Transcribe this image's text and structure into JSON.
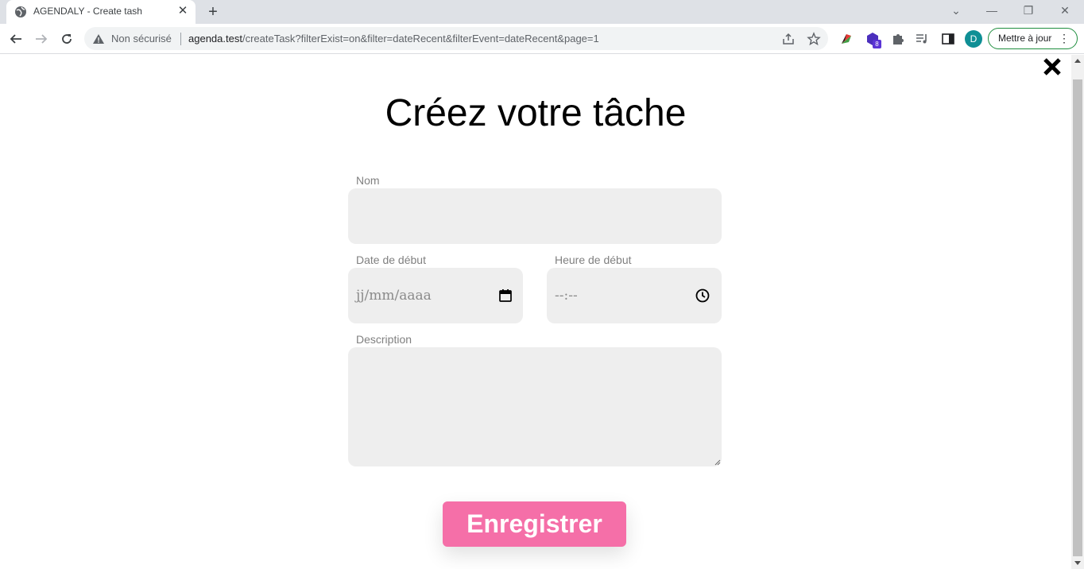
{
  "browser": {
    "tab_title": "AGENDALY - Create tash",
    "security_label": "Non sécurisé",
    "url_host": "agenda.test",
    "url_path": "/createTask?filterExist=on&filter=dateRecent&filterEvent=dateRecent&page=1",
    "extension_badge": "8",
    "profile_initial": "D",
    "update_button": "Mettre à jour"
  },
  "page": {
    "title": "Créez votre tâche",
    "fields": {
      "name_label": "Nom",
      "name_value": "",
      "date_label": "Date de début",
      "date_placeholder": "jj/mm/aaaa",
      "time_label": "Heure de début",
      "time_placeholder": "--:--",
      "description_label": "Description",
      "description_value": ""
    },
    "submit_label": "Enregistrer"
  },
  "colors": {
    "submit_button": "#f56fa8",
    "field_background": "#eeeeee",
    "label_text": "#808080",
    "update_border": "#1e8e3e"
  },
  "icons": {
    "close": "close-x-icon",
    "calendar": "calendar-icon",
    "clock": "clock-icon"
  }
}
